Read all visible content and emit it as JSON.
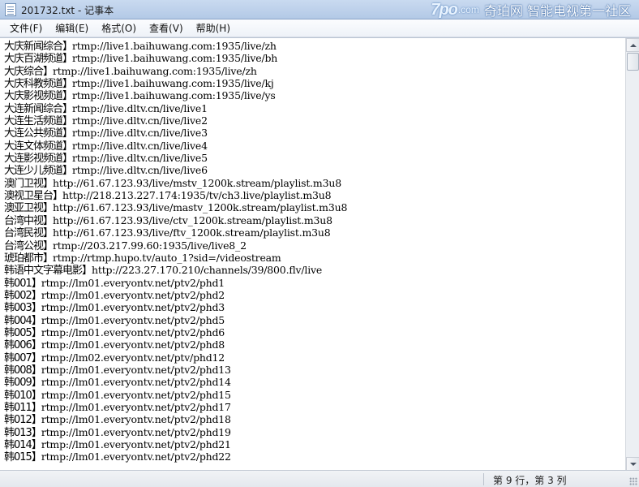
{
  "window": {
    "title": "201732.txt - 记事本"
  },
  "brand": {
    "logo": "7po",
    "domain": ".com",
    "tagline": "奇珀网 智能电视第一社区"
  },
  "menu": [
    "文件(F)",
    "编辑(E)",
    "格式(O)",
    "查看(V)",
    "帮助(H)"
  ],
  "lines": [
    {
      "name": "大庆新闻综合】",
      "url": "rtmp://live1.baihuwang.com:1935/live/zh"
    },
    {
      "name": "大庆百湖频道】",
      "url": "rtmp://live1.baihuwang.com:1935/live/bh"
    },
    {
      "name": "大庆综合】",
      "url": "rtmp://live1.baihuwang.com:1935/live/zh"
    },
    {
      "name": "大庆科教频道】",
      "url": "rtmp://live1.baihuwang.com:1935/live/kj"
    },
    {
      "name": "大庆影视频道】",
      "url": "rtmp://live1.baihuwang.com:1935/live/ys"
    },
    {
      "name": "大连新闻综合】",
      "url": "rtmp://live.dltv.cn/live/live1"
    },
    {
      "name": "大连生活频道】",
      "url": "rtmp://live.dltv.cn/live/live2"
    },
    {
      "name": "大连公共频道】",
      "url": "rtmp://live.dltv.cn/live/live3"
    },
    {
      "name": "大连文体频道】",
      "url": "rtmp://live.dltv.cn/live/live4"
    },
    {
      "name": "大连影视频道】",
      "url": "rtmp://live.dltv.cn/live/live5"
    },
    {
      "name": "大连少儿频道】",
      "url": "rtmp://live.dltv.cn/live/live6"
    },
    {
      "name": "澳门卫视】",
      "url": "http://61.67.123.93/live/mstv_1200k.stream/playlist.m3u8"
    },
    {
      "name": "澳视卫星台】",
      "url": "http://218.213.227.174:1935/tv/ch3.live/playlist.m3u8"
    },
    {
      "name": "澳亚卫视】",
      "url": "http://61.67.123.93/live/mastv_1200k.stream/playlist.m3u8"
    },
    {
      "name": "台湾中视】",
      "url": "http://61.67.123.93/live/ctv_1200k.stream/playlist.m3u8"
    },
    {
      "name": "台湾民视】",
      "url": "http://61.67.123.93/live/ftv_1200k.stream/playlist.m3u8"
    },
    {
      "name": "台湾公视】",
      "url": "rtmp://203.217.99.60:1935/live/live8_2"
    },
    {
      "name": "琥珀都市】",
      "url": "rtmp://rtmp.hupo.tv/auto_1?sid=/videostream"
    },
    {
      "name": "韩语中文字幕电影】",
      "url": "http://223.27.170.210/channels/39/800.flv/live"
    },
    {
      "name": "韩001】",
      "url": "rtmp://lm01.everyontv.net/ptv2/phd1"
    },
    {
      "name": "韩002】",
      "url": "rtmp://lm01.everyontv.net/ptv2/phd2"
    },
    {
      "name": "韩003】",
      "url": "rtmp://lm01.everyontv.net/ptv2/phd3"
    },
    {
      "name": "韩004】",
      "url": "rtmp://lm01.everyontv.net/ptv2/phd5"
    },
    {
      "name": "韩005】",
      "url": "rtmp://lm01.everyontv.net/ptv2/phd6"
    },
    {
      "name": "韩006】",
      "url": "rtmp://lm01.everyontv.net/ptv2/phd8"
    },
    {
      "name": "韩007】",
      "url": "rtmp://lm02.everyontv.net/ptv/phd12"
    },
    {
      "name": "韩008】",
      "url": "rtmp://lm01.everyontv.net/ptv2/phd13"
    },
    {
      "name": "韩009】",
      "url": "rtmp://lm01.everyontv.net/ptv2/phd14"
    },
    {
      "name": "韩010】",
      "url": "rtmp://lm01.everyontv.net/ptv2/phd15"
    },
    {
      "name": "韩011】",
      "url": "rtmp://lm01.everyontv.net/ptv2/phd17"
    },
    {
      "name": "韩012】",
      "url": "rtmp://lm01.everyontv.net/ptv2/phd18"
    },
    {
      "name": "韩013】",
      "url": "rtmp://lm01.everyontv.net/ptv2/phd19"
    },
    {
      "name": "韩014】",
      "url": "rtmp://lm01.everyontv.net/ptv2/phd21"
    },
    {
      "name": "韩015】",
      "url": "rtmp://lm01.everyontv.net/ptv2/phd22"
    }
  ],
  "status": {
    "position": "第 9 行，第 3 列"
  }
}
